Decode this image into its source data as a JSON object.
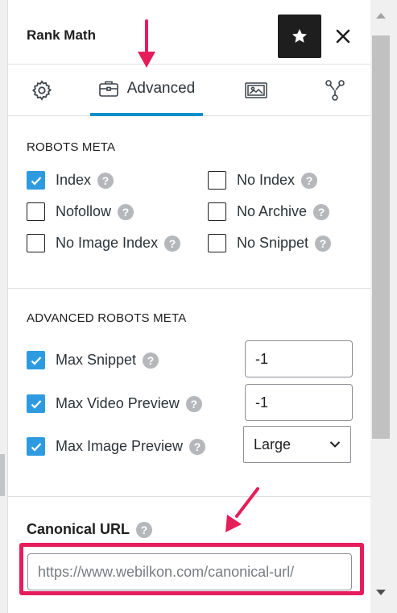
{
  "header": {
    "title": "Rank Math"
  },
  "tabs": [
    {
      "id": "general",
      "label": "",
      "icon": "gear-icon"
    },
    {
      "id": "advanced",
      "label": "Advanced",
      "icon": "briefcase-icon"
    },
    {
      "id": "social",
      "label": "",
      "icon": "social-card-icon"
    },
    {
      "id": "schema",
      "label": "",
      "icon": "schema-nodes-icon"
    }
  ],
  "robots_meta": {
    "title": "ROBOTS META",
    "options": [
      {
        "label": "Index",
        "checked": true
      },
      {
        "label": "No Index",
        "checked": false
      },
      {
        "label": "Nofollow",
        "checked": false
      },
      {
        "label": "No Archive",
        "checked": false
      },
      {
        "label": "No Image Index",
        "checked": false
      },
      {
        "label": "No Snippet",
        "checked": false
      }
    ]
  },
  "advanced_robots_meta": {
    "title": "ADVANCED ROBOTS META",
    "rows": [
      {
        "label": "Max Snippet",
        "checked": true,
        "value": "-1"
      },
      {
        "label": "Max Video Preview",
        "checked": true,
        "value": "-1"
      },
      {
        "label": "Max Image Preview",
        "checked": true,
        "value": "Large"
      }
    ]
  },
  "canonical": {
    "label": "Canonical URL",
    "placeholder": "https://www.webilkon.com/canonical-url/"
  },
  "help_glyph": "?",
  "colors": {
    "accent": "#0b8fc9",
    "checkbox": "#2e9be0",
    "annotation": "#e51e5b"
  }
}
